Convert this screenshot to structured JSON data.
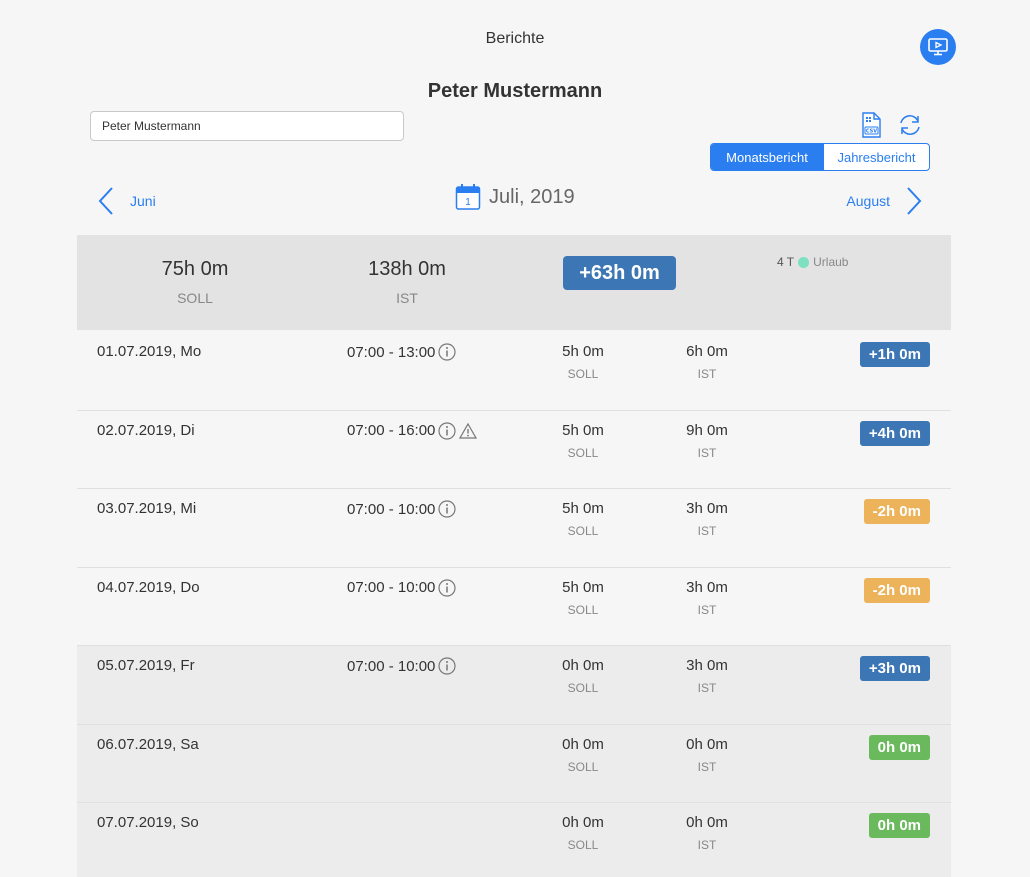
{
  "header": {
    "title": "Berichte"
  },
  "person": {
    "name": "Peter Mustermann",
    "input_value": "Peter Mustermann"
  },
  "report_toggle": {
    "monthly": "Monatsbericht",
    "yearly": "Jahresbericht",
    "selected": "Monatsbericht"
  },
  "navigation": {
    "prev_label": "Juni",
    "current_label": "Juli, 2019",
    "calendar_day": "1",
    "next_label": "August"
  },
  "summary": {
    "soll_value": "75h 0m",
    "soll_label": "SOLL",
    "ist_value": "138h 0m",
    "ist_label": "IST",
    "diff": "+63h 0m",
    "vacation_count": "4 T",
    "vacation_label": "Urlaub"
  },
  "colors": {
    "accent": "#2a7ef0",
    "positive": "#3d76b4",
    "negative": "#edb35a",
    "zero": "#6ab95d"
  },
  "rows": [
    {
      "date": "01.07.2019, Mo",
      "time": "07:00 - 13:00",
      "warning": false,
      "soll": "5h 0m",
      "soll_label": "SOLL",
      "ist": "6h 0m",
      "ist_label": "IST",
      "diff": "+1h 0m",
      "status": "positive"
    },
    {
      "date": "02.07.2019, Di",
      "time": "07:00 - 16:00",
      "warning": true,
      "soll": "5h 0m",
      "soll_label": "SOLL",
      "ist": "9h 0m",
      "ist_label": "IST",
      "diff": "+4h 0m",
      "status": "positive"
    },
    {
      "date": "03.07.2019, Mi",
      "time": "07:00 - 10:00",
      "warning": false,
      "soll": "5h 0m",
      "soll_label": "SOLL",
      "ist": "3h 0m",
      "ist_label": "IST",
      "diff": "-2h 0m",
      "status": "negative"
    },
    {
      "date": "04.07.2019, Do",
      "time": "07:00 - 10:00",
      "warning": false,
      "soll": "5h 0m",
      "soll_label": "SOLL",
      "ist": "3h 0m",
      "ist_label": "IST",
      "diff": "-2h 0m",
      "status": "negative"
    },
    {
      "date": "05.07.2019, Fr",
      "time": "07:00 - 10:00",
      "warning": false,
      "soll": "0h 0m",
      "soll_label": "SOLL",
      "ist": "3h 0m",
      "ist_label": "IST",
      "diff": "+3h 0m",
      "status": "positive"
    },
    {
      "date": "06.07.2019, Sa",
      "time": "",
      "warning": false,
      "soll": "0h 0m",
      "soll_label": "SOLL",
      "ist": "0h 0m",
      "ist_label": "IST",
      "diff": "0h 0m",
      "status": "zero"
    },
    {
      "date": "07.07.2019, So",
      "time": "",
      "warning": false,
      "soll": "0h 0m",
      "soll_label": "SOLL",
      "ist": "0h 0m",
      "ist_label": "IST",
      "diff": "0h 0m",
      "status": "zero"
    }
  ]
}
